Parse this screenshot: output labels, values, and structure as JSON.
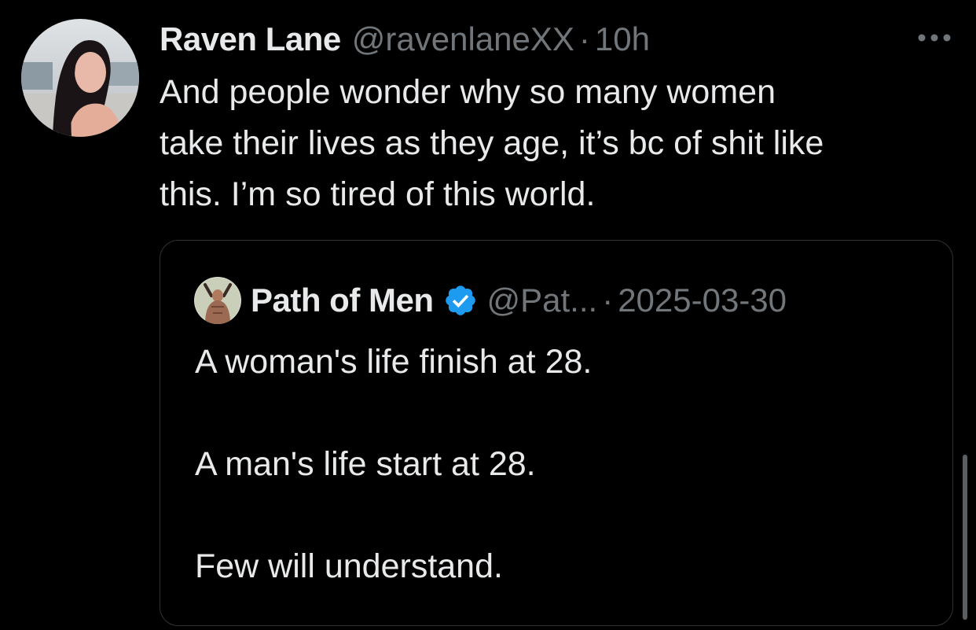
{
  "tweet": {
    "display_name": "Raven Lane",
    "handle": "@ravenlaneXX",
    "separator": "·",
    "time": "10h",
    "body": "And people wonder why so many women\ntake their lives as they age, it’s bc of shit like\nthis. I’m so tired of this world.",
    "more_icon": "more-horizontal-icon"
  },
  "quoted_tweet": {
    "display_name": "Path of Men",
    "verified_icon": "verified-badge-icon",
    "handle": "@Pat...",
    "separator": "·",
    "date": "2025-03-30",
    "body": "A woman's life finish at 28.\n\nA man's life start at 28.\n\nFew will understand."
  },
  "colors": {
    "background": "#000000",
    "primary_text": "#e7e9ea",
    "secondary_text": "#71767b",
    "border": "#2f3336",
    "verified": "#1d9bf0"
  }
}
